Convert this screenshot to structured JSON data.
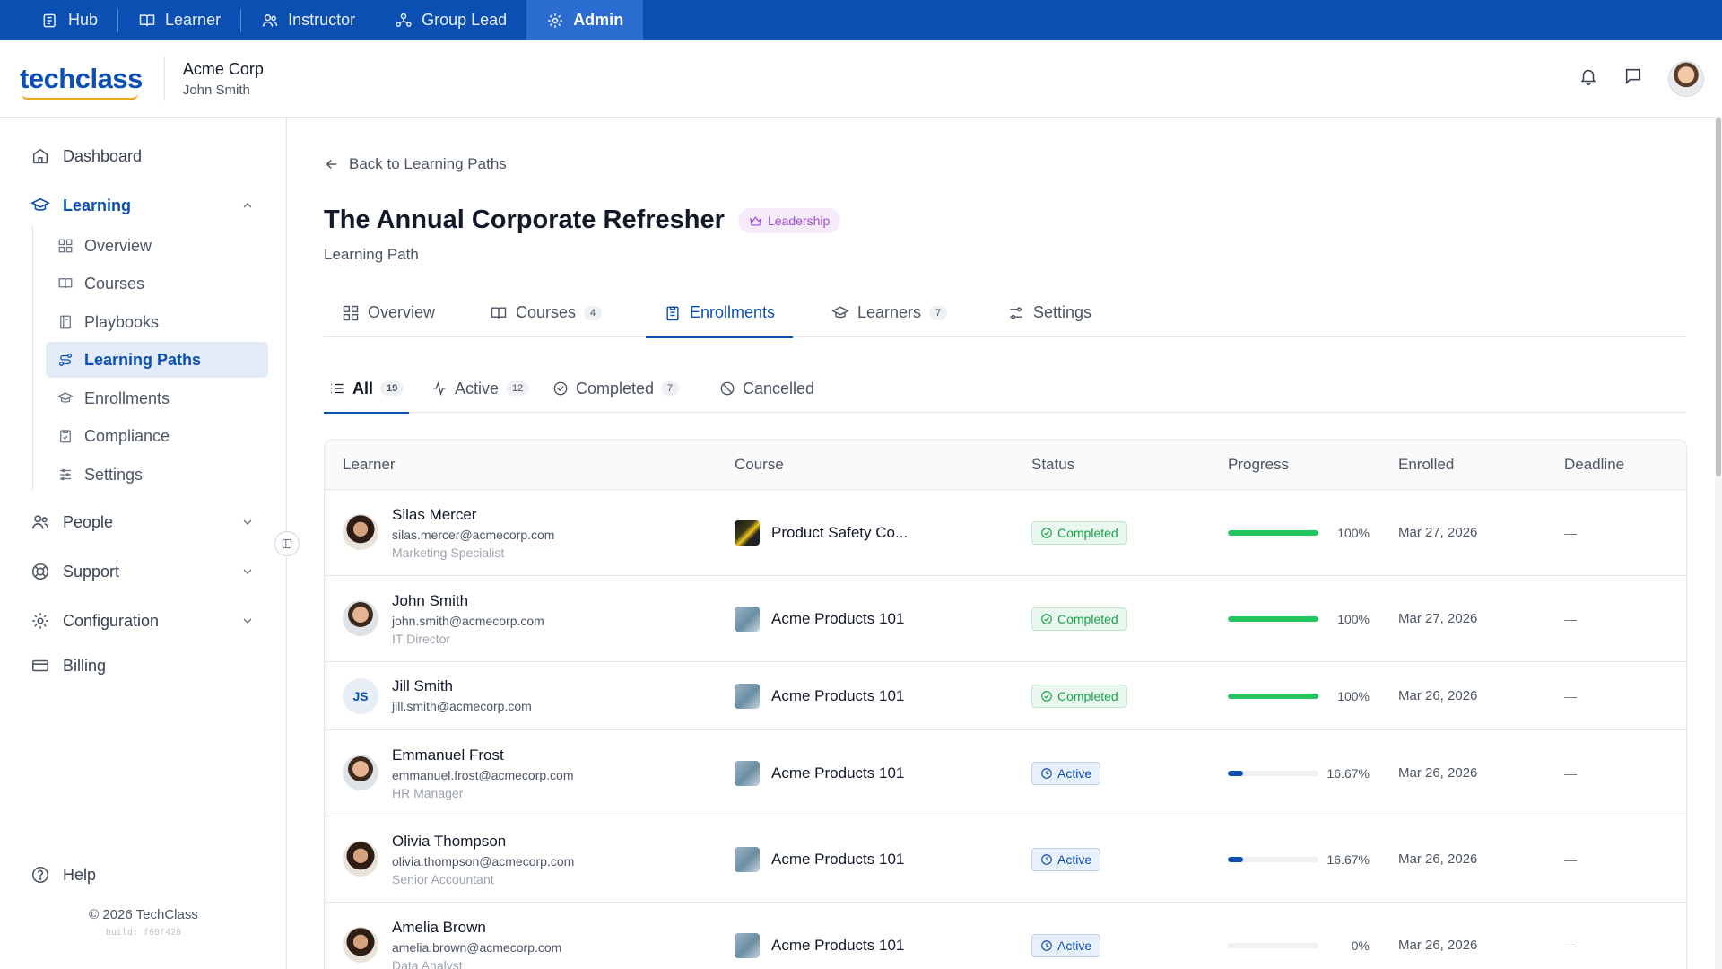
{
  "roles": [
    {
      "label": "Hub",
      "icon": "hub-icon"
    },
    {
      "label": "Learner",
      "icon": "book-icon"
    },
    {
      "label": "Instructor",
      "icon": "users-icon"
    },
    {
      "label": "Group Lead",
      "icon": "group-icon"
    },
    {
      "label": "Admin",
      "icon": "gear-icon",
      "active": true
    }
  ],
  "header": {
    "logo": "techclass",
    "org_name": "Acme Corp",
    "user_name": "John Smith"
  },
  "sidebar": {
    "dashboard": "Dashboard",
    "learning": "Learning",
    "learning_items": [
      {
        "label": "Overview"
      },
      {
        "label": "Courses"
      },
      {
        "label": "Playbooks"
      },
      {
        "label": "Learning Paths",
        "active": true
      },
      {
        "label": "Enrollments"
      },
      {
        "label": "Compliance"
      },
      {
        "label": "Settings"
      }
    ],
    "people": "People",
    "support": "Support",
    "configuration": "Configuration",
    "billing": "Billing",
    "help": "Help",
    "copyright": "© 2026 TechClass",
    "build": "build: f60f420"
  },
  "page": {
    "back_label": "Back to Learning Paths",
    "title": "The Annual Corporate Refresher",
    "tag": "Leadership",
    "subtitle": "Learning Path"
  },
  "tabs": [
    {
      "label": "Overview",
      "count": ""
    },
    {
      "label": "Courses",
      "count": "4"
    },
    {
      "label": "Enrollments",
      "count": "",
      "active": true
    },
    {
      "label": "Learners",
      "count": "7"
    },
    {
      "label": "Settings",
      "count": ""
    }
  ],
  "filters": [
    {
      "label": "All",
      "count": "19",
      "active": true
    },
    {
      "label": "Active",
      "count": "12"
    },
    {
      "label": "Completed",
      "count": "7"
    },
    {
      "label": "Cancelled",
      "count": ""
    }
  ],
  "table": {
    "columns": [
      "Learner",
      "Course",
      "Status",
      "Progress",
      "Enrolled",
      "Deadline"
    ],
    "rows": [
      {
        "name": "Silas Mercer",
        "email": "silas.mercer@acmecorp.com",
        "title": "Marketing Specialist",
        "course": "Product Safety Co...",
        "status": "Completed",
        "progress": 1.0,
        "progress_label": "100%",
        "enrolled": "Mar 27, 2026",
        "deadline": "—"
      },
      {
        "name": "John Smith",
        "email": "john.smith@acmecorp.com",
        "title": "IT Director",
        "course": "Acme Products 101",
        "status": "Completed",
        "progress": 1.0,
        "progress_label": "100%",
        "enrolled": "Mar 27, 2026",
        "deadline": "—"
      },
      {
        "name": "Jill Smith",
        "email": "jill.smith@acmecorp.com",
        "title": "",
        "initials": "JS",
        "course": "Acme Products 101",
        "status": "Completed",
        "progress": 1.0,
        "progress_label": "100%",
        "enrolled": "Mar 26, 2026",
        "deadline": "—"
      },
      {
        "name": "Emmanuel Frost",
        "email": "emmanuel.frost@acmecorp.com",
        "title": "HR Manager",
        "course": "Acme Products 101",
        "status": "Active",
        "progress": 0.1667,
        "progress_label": "16.67%",
        "enrolled": "Mar 26, 2026",
        "deadline": "—"
      },
      {
        "name": "Olivia Thompson",
        "email": "olivia.thompson@acmecorp.com",
        "title": "Senior Accountant",
        "course": "Acme Products 101",
        "status": "Active",
        "progress": 0.1667,
        "progress_label": "16.67%",
        "enrolled": "Mar 26, 2026",
        "deadline": "—"
      },
      {
        "name": "Amelia Brown",
        "email": "amelia.brown@acmecorp.com",
        "title": "Data Analyst",
        "course": "Acme Products 101",
        "status": "Active",
        "progress": 0,
        "progress_label": "0%",
        "enrolled": "Mar 26, 2026",
        "deadline": "—"
      }
    ]
  },
  "colors": {
    "primary": "#0b4fb3",
    "success": "#16a34a",
    "tag": "#a24ad1"
  }
}
